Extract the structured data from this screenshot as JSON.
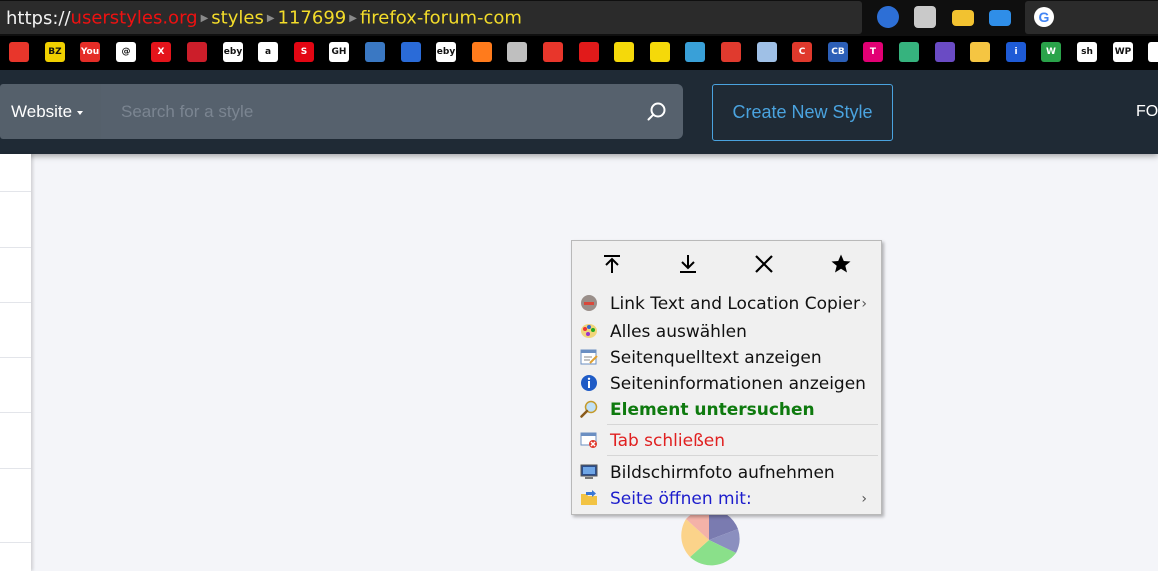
{
  "browser": {
    "url": {
      "protocol": "https://",
      "host": "userstyles.org",
      "segments": [
        "styles",
        "117699",
        "firefox-forum-com"
      ]
    },
    "toolbar_icons": [
      "blue-globe-icon",
      "android-robot-icon",
      "folder-open-icon",
      "blue-folder-icon"
    ],
    "search_engine_icon": "google-icon",
    "bookmarks": [
      {
        "icon": "firefox-icon",
        "color": "#e8362b",
        "text": ""
      },
      {
        "icon": "bz-icon",
        "color": "#f0d000",
        "text": "BZ"
      },
      {
        "icon": "youtube-icon",
        "color": "#e52d27",
        "text": "You"
      },
      {
        "icon": "at-icon",
        "color": "#ffffff",
        "text": "@"
      },
      {
        "icon": "x-icon",
        "color": "#e4141b",
        "text": "X"
      },
      {
        "icon": "news-icon",
        "color": "#cc1e2a",
        "text": ""
      },
      {
        "icon": "ebay-icon",
        "color": "#ffffff",
        "text": "eby"
      },
      {
        "icon": "amazon-icon",
        "color": "#ffffff",
        "text": "a"
      },
      {
        "icon": "sparkasse-icon",
        "color": "#e30613",
        "text": "S"
      },
      {
        "icon": "gh-icon",
        "color": "#ffffff",
        "text": "GH"
      },
      {
        "icon": "monitor-icon",
        "color": "#3a78c3",
        "text": ""
      },
      {
        "icon": "rocket-icon",
        "color": "#2a6bd8",
        "text": ""
      },
      {
        "icon": "ebay-icon",
        "color": "#ffffff",
        "text": "eby"
      },
      {
        "icon": "firefox-icon",
        "color": "#ff7b1c",
        "text": ""
      },
      {
        "icon": "circle-icon",
        "color": "#bfbfbf",
        "text": ""
      },
      {
        "icon": "firefox-icon",
        "color": "#e8362b",
        "text": ""
      },
      {
        "icon": "red-square-icon",
        "color": "#e11a1a",
        "text": ""
      },
      {
        "icon": "smiley-icon",
        "color": "#f5d90a",
        "text": ""
      },
      {
        "icon": "smiley-icon",
        "color": "#f5d90a",
        "text": ""
      },
      {
        "icon": "palm-icon",
        "color": "#39a0d8",
        "text": ""
      },
      {
        "icon": "ribbon-icon",
        "color": "#e03a2e",
        "text": ""
      },
      {
        "icon": "notepad-icon",
        "color": "#9fc0e6",
        "text": ""
      },
      {
        "icon": "c-icon",
        "color": "#e0392c",
        "text": "C"
      },
      {
        "icon": "cb-icon",
        "color": "#2c5fb7",
        "text": "CB"
      },
      {
        "icon": "telekom-icon",
        "color": "#e20074",
        "text": "T"
      },
      {
        "icon": "diamond-icon",
        "color": "#36b37e",
        "text": ""
      },
      {
        "icon": "arrows-icon",
        "color": "#6a4bc4",
        "text": ""
      },
      {
        "icon": "folder-icon",
        "color": "#f5c542",
        "text": ""
      },
      {
        "icon": "info-icon",
        "color": "#1e5bd6",
        "text": "i"
      },
      {
        "icon": "w3-icon",
        "color": "#2aa34a",
        "text": "W"
      },
      {
        "icon": "sh-icon",
        "color": "#ffffff",
        "text": "sh"
      },
      {
        "icon": "wp-icon",
        "color": "#ffffff",
        "text": "WP"
      },
      {
        "icon": "pencil-icon",
        "color": "#ffffff",
        "text": ""
      }
    ]
  },
  "site": {
    "website_dropdown": "Website",
    "search_placeholder": "Search for a style",
    "create_button": "Create New Style",
    "nav_label": "FO"
  },
  "context_menu": {
    "nav_buttons": [
      {
        "icon": "scroll-top-icon"
      },
      {
        "icon": "download-icon"
      },
      {
        "icon": "close-icon"
      },
      {
        "icon": "bookmark-star-icon"
      }
    ],
    "items": [
      {
        "label": "Link Text and Location Copier",
        "icon": "copier-icon",
        "color": "#111111",
        "bold": false,
        "submenu": true
      },
      {
        "label": "Alles auswählen",
        "icon": "palette-icon",
        "color": "#111111",
        "bold": false,
        "submenu": false
      },
      {
        "label": "Seitenquelltext anzeigen",
        "icon": "source-icon",
        "color": "#111111",
        "bold": false,
        "submenu": false
      },
      {
        "label": "Seiteninformationen anzeigen",
        "icon": "info-icon",
        "color": "#111111",
        "bold": false,
        "submenu": false
      },
      {
        "label": "Element untersuchen",
        "icon": "magnifier-icon",
        "color": "#0e7a0e",
        "bold": true,
        "submenu": false
      },
      {
        "label": "Tab schließen",
        "icon": "close-tab-icon",
        "color": "#e02020",
        "bold": false,
        "submenu": false
      },
      {
        "label": "Bildschirmfoto aufnehmen",
        "icon": "screenshot-icon",
        "color": "#111111",
        "bold": false,
        "submenu": false
      },
      {
        "label": "Seite öffnen mit:",
        "icon": "open-with-icon",
        "color": "#1d1dcc",
        "bold": false,
        "submenu": true
      }
    ],
    "submenu_arrow": "›"
  }
}
